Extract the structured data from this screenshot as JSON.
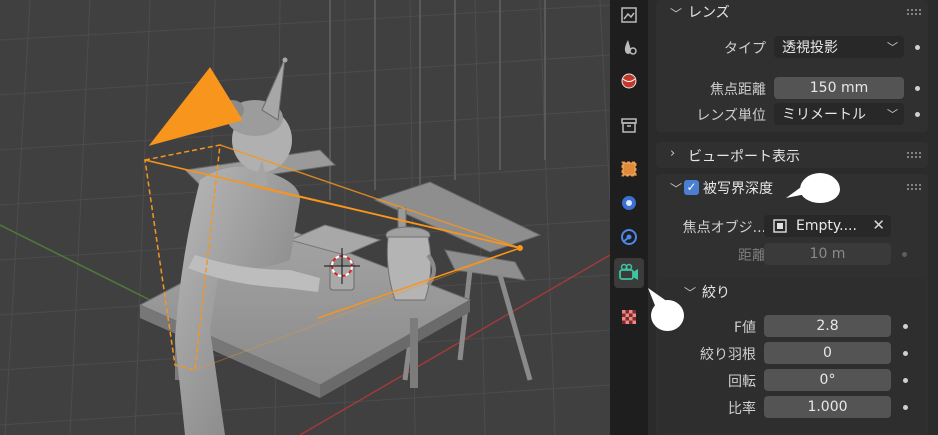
{
  "properties": {
    "lens_panel": {
      "title": "レンズ",
      "type_label": "タイプ",
      "type_value": "透視投影",
      "focal_length_label": "焦点距離",
      "focal_length_value": "150 mm",
      "lens_unit_label": "レンズ単位",
      "lens_unit_value": "ミリメートル"
    },
    "viewport_display_panel": {
      "title": "ビューポート表示"
    },
    "dof_panel": {
      "title": "被写界深度",
      "enabled": true,
      "focus_object_label": "焦点オブジ...",
      "focus_object_value": "Empty....",
      "distance_label": "距離",
      "distance_value": "10 m"
    },
    "aperture_panel": {
      "title": "絞り",
      "fstop_label": "F値",
      "fstop_value": "2.8",
      "blades_label": "絞り羽根",
      "blades_value": "0",
      "rotation_label": "回転",
      "rotation_value": "0°",
      "ratio_label": "比率",
      "ratio_value": "1.000"
    }
  },
  "tabs": [
    {
      "name": "render-tab-icon"
    },
    {
      "name": "particles-tab-icon"
    },
    {
      "name": "physics-tab-icon"
    },
    {
      "name": "collection-tab-icon"
    },
    {
      "name": "object-tab-icon"
    },
    {
      "name": "modifier-tab-icon"
    },
    {
      "name": "constraints-tab-icon"
    },
    {
      "name": "camera-data-tab-icon",
      "active": true
    },
    {
      "name": "texture-tab-icon"
    }
  ],
  "colors": {
    "camera_orange": "#f7951d",
    "checkbox_blue": "#4a7fd1",
    "active_tab_icon": "#3ec4a3",
    "viewport_bg": "#404040"
  }
}
